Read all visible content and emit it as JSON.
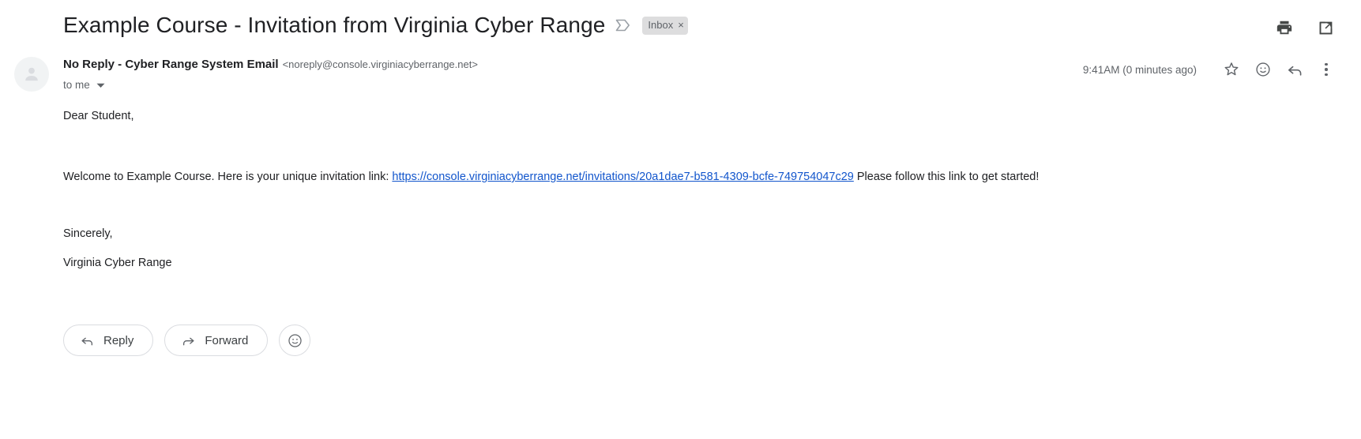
{
  "header": {
    "subject": "Example Course - Invitation from Virginia Cyber Range",
    "important_marker_icon": "important-marker-icon",
    "label_chip": {
      "text": "Inbox",
      "close": "×"
    },
    "actions": [
      {
        "name": "print-icon",
        "label": "Print all"
      },
      {
        "name": "open-in-new-window-icon",
        "label": "Open in new window"
      }
    ]
  },
  "message": {
    "avatar_icon": "avatar-person-icon",
    "sender_name": "No Reply - Cyber Range System Email",
    "sender_email": "<noreply@console.virginiacyberrange.net>",
    "recipient": "to me",
    "recipient_caret_icon": "chevron-down-icon",
    "timestamp": "9:41AM (0 minutes ago)",
    "actions": [
      {
        "name": "star-icon",
        "label": "Star"
      },
      {
        "name": "add-reaction-icon",
        "label": "Add emoji reaction"
      },
      {
        "name": "reply-icon",
        "label": "Reply"
      },
      {
        "name": "more-options-icon",
        "label": "More"
      }
    ]
  },
  "body": {
    "greeting": "Dear Student,",
    "intro": "Welcome to Example Course. Here is your unique invitation link:",
    "link_text": "https://console.virginiacyberrange.net/invitations/20a1dae7-b581-4309-bcfe-749754047c29",
    "link_href": "https://console.virginiacyberrange.net/invitations/20a1dae7-b581-4309-bcfe-749754047c29",
    "outro": "Please follow this link to get started!",
    "closing": "Sincerely,",
    "signature": "Virginia Cyber Range"
  },
  "footer": {
    "reply_label": "Reply",
    "forward_label": "Forward",
    "reply_icon": "reply-arrow-icon",
    "forward_icon": "forward-arrow-icon",
    "emoji_icon": "add-reaction-icon"
  },
  "colors": {
    "link": "#1155cc",
    "text": "#202124",
    "muted": "#5f6368",
    "chip_bg": "#ddddde",
    "border": "#dadce0"
  }
}
